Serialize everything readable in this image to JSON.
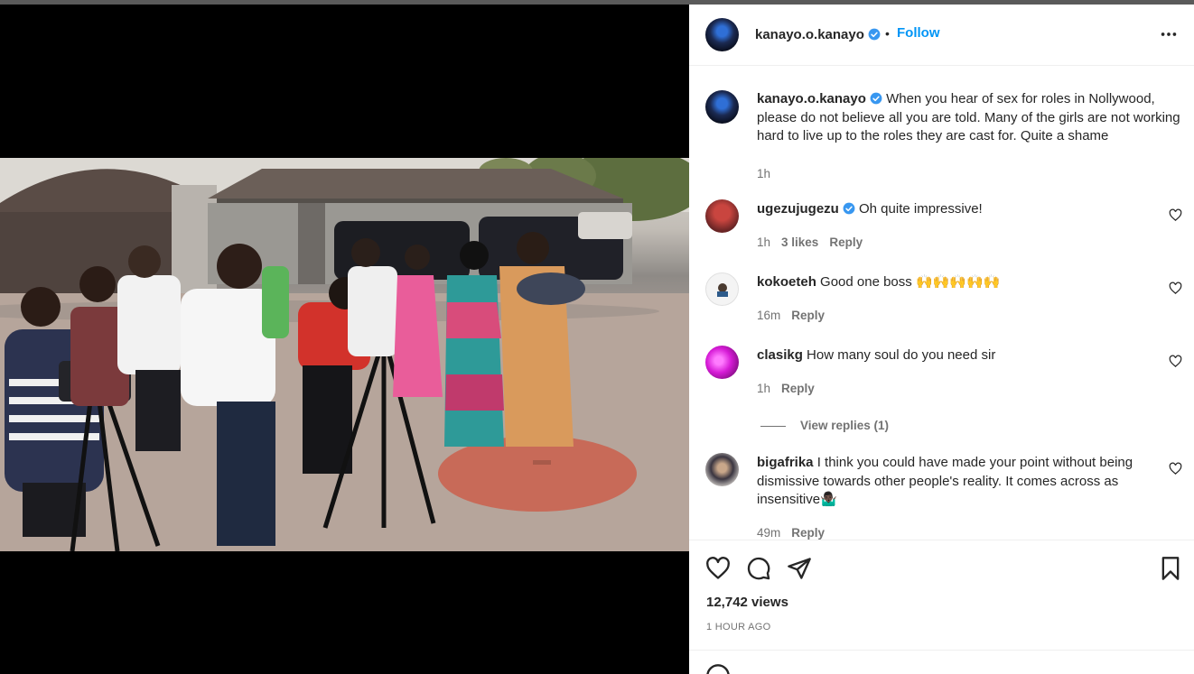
{
  "post": {
    "username": "kanayo.o.kanayo",
    "follow_label": "Follow",
    "caption": "When you hear of sex for roles in Nollywood, please do not believe all you are told. Many of the girls are not working hard to live up to the roles they are cast for. Quite a shame",
    "caption_time": "1h",
    "views": "12,742 views",
    "posted_ago": "1 HOUR AGO"
  },
  "comments": [
    {
      "username": "ugezujugezu",
      "verified": true,
      "text": "Oh quite impressive!",
      "time": "1h",
      "likes": "3 likes",
      "reply_label": "Reply",
      "avatar_color": "#7a2a2a"
    },
    {
      "username": "kokoeteh",
      "verified": false,
      "text": "Good one boss 🙌🙌🙌🙌🙌",
      "time": "16m",
      "reply_label": "Reply",
      "avatar_color": "#f2f2f2"
    },
    {
      "username": "clasikg",
      "verified": false,
      "text": "How many soul do you need sir",
      "time": "1h",
      "reply_label": "Reply",
      "avatar_color": "#d61bd6",
      "view_replies": "View replies (1)"
    },
    {
      "username": "bigafrika",
      "verified": false,
      "text": "I think you could have made your point without being dismissive towards other people's reality. It comes across as insensitive🤷🏿‍♂️",
      "time": "49m",
      "reply_label": "Reply",
      "avatar_color": "#5a4a3a"
    }
  ],
  "icons": {
    "verified": "verified-badge-icon",
    "more": "more-options-icon",
    "like": "heart-icon",
    "comment": "comment-icon",
    "share": "share-icon",
    "save": "bookmark-icon",
    "mute": "muted-speaker-icon"
  },
  "colors": {
    "accent": "#0095f6",
    "verified": "#3897f0",
    "muted_text": "#737373"
  }
}
